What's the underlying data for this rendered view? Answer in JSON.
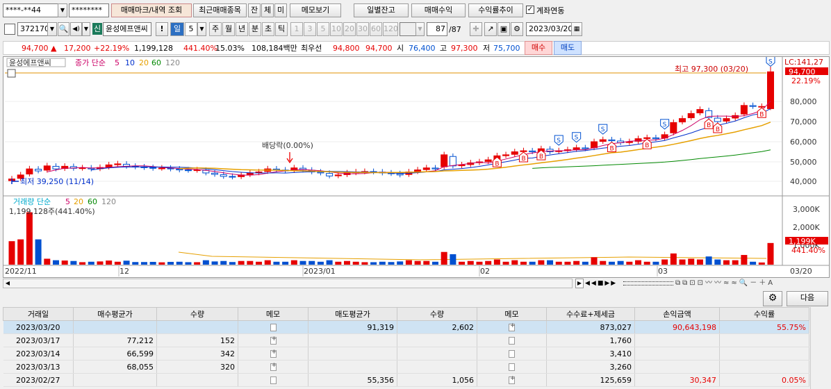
{
  "toolbar1": {
    "account": "****-**44",
    "password": "********",
    "btn_trade_mark": "매매마크/내역 조회",
    "btn_recent": "최근매매종목",
    "btn_jan": "잔",
    "btn_che": "체",
    "btn_mi": "미",
    "btn_memo": "메모보기",
    "btn_daily": "일별잔고",
    "btn_profit": "매매수익",
    "btn_trend": "수익률추이",
    "link_account_label": "계좌연동"
  },
  "toolbar2": {
    "code": "372170",
    "shin": "신",
    "stock_name": "윤성에프앤씨",
    "excl": "!",
    "period_day": "일",
    "period_num": "5",
    "period_week": "주",
    "period_month": "월",
    "period_year": "년",
    "period_min": "분",
    "period_sec": "초",
    "period_tick": "틱",
    "n1": "1",
    "n3": "3",
    "n5": "5",
    "n10": "10",
    "n20": "20",
    "n30": "30",
    "n60": "60",
    "n120": "120",
    "count": "87",
    "count_total": "/87",
    "date": "2023/03/20"
  },
  "quote": {
    "price": "94,700",
    "change": "17,200",
    "change_pct": "+22.19%",
    "volume": "1,199,128",
    "vol_pct": "441.40%",
    "turnover": "15.03%",
    "amount": "108,184백만",
    "best_label": "최우선",
    "best_ask": "94,800",
    "best_bid": "94,700",
    "open_label": "시",
    "open": "76,400",
    "high_label": "고",
    "high": "97,300",
    "low_label": "저",
    "low": "75,700",
    "buy": "매수",
    "sell": "매도"
  },
  "chart": {
    "stock_label": "윤성에프앤씨",
    "ma_label": "종가 단순",
    "ma_periods": [
      "5",
      "10",
      "20",
      "60",
      "120"
    ],
    "lc": "LC:141,27",
    "last_price_tag": "94,700",
    "last_pct_tag": "22.19%",
    "high_note": "최고 97,300 (03/20)",
    "low_note": "최저 39,250 (11/14)",
    "dividend_note": "배당락(0.00%)",
    "price_ticks": [
      "80,000",
      "70,000",
      "60,000",
      "50,000",
      "40,000"
    ],
    "volume_label": "거래량 단순",
    "vol_ma_periods": [
      "5",
      "20",
      "60",
      "120"
    ],
    "vol_value": "1,199,128주(441.40%)",
    "vol_ticks": [
      "3,000K",
      "2,000K",
      "1,000K"
    ],
    "vol_tag": "1,199K",
    "vol_pct_tag": "441.40%",
    "x_labels": [
      "2022/11",
      "12",
      "2023/01",
      "02",
      "03"
    ],
    "x_last": "03/20",
    "colors": {
      "up": "#e60000",
      "down": "#0050d0",
      "ma5": "#cc0066",
      "ma10": "#0030cc",
      "ma20": "#e6a000",
      "ma60": "#008800",
      "ma120": "#888888"
    }
  },
  "table": {
    "gear": "⚙",
    "next": "다음",
    "headers": [
      "거래일",
      "매수평균가",
      "수량",
      "메모",
      "매도평균가",
      "수량",
      "메모",
      "수수료+제세금",
      "손익금액",
      "수익률"
    ],
    "rows": [
      [
        "2023/03/20",
        "",
        "",
        "",
        "91,319",
        "2,602",
        "+",
        "873,027",
        "90,643,198",
        "55.75%"
      ],
      [
        "2023/03/17",
        "77,212",
        "152",
        "+",
        "",
        "",
        "",
        "1,760",
        "",
        ""
      ],
      [
        "2023/03/14",
        "66,599",
        "342",
        "+",
        "",
        "",
        "",
        "3,410",
        "",
        ""
      ],
      [
        "2023/03/13",
        "68,055",
        "320",
        "+",
        "",
        "",
        "",
        "3,260",
        "",
        ""
      ],
      [
        "2023/02/27",
        "",
        "",
        "",
        "55,356",
        "1,056",
        "+",
        "125,659",
        "30,347",
        "0.05%"
      ]
    ]
  }
}
